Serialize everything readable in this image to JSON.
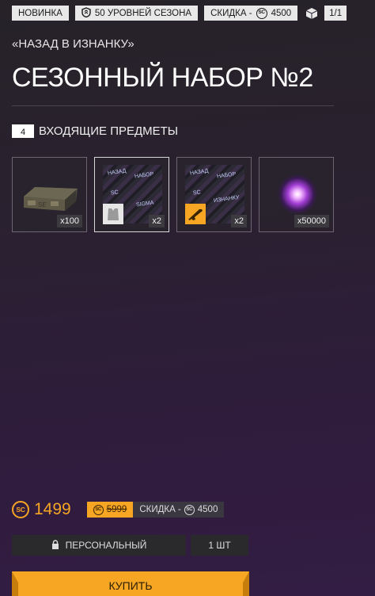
{
  "tags": {
    "new": "НОВИНКА",
    "season_levels": "50 УРОВНЕЙ СЕЗОНА",
    "discount_label": "СКИДКА -",
    "discount_value": "4500",
    "currency_code": "SC",
    "pack_count": "1/1"
  },
  "back_link": "«НАЗАД В ИЗНАНКУ»",
  "title": "СЕЗОННЫЙ НАБОР №2",
  "items_section": {
    "count": "4",
    "label": "ВХОДЯЩИЕ ПРЕДМЕТЫ"
  },
  "items": [
    {
      "name": "ammo-crate",
      "qty": "x100"
    },
    {
      "name": "skin-pattern-vest",
      "qty": "x2"
    },
    {
      "name": "skin-pattern-rifle",
      "qty": "x2"
    },
    {
      "name": "purple-orb",
      "qty": "x50000"
    }
  ],
  "pattern_texts": [
    "НАЗАД",
    "НАБОР",
    "SC",
    "SIGMA",
    "ИЗНАНКУ"
  ],
  "purchase": {
    "price": "1499",
    "old_price": "5999",
    "discount_label": "СКИДКА -",
    "discount_value": "4500",
    "personal_label": "ПЕРСОНАЛЬНЫЙ",
    "quantity_label": "1 ШТ",
    "buy_label": "КУПИТЬ"
  },
  "colors": {
    "accent": "#f6a623",
    "tag_bg": "#e8e8e8",
    "bg_top": "#262228",
    "bg_bottom": "#331d44"
  }
}
